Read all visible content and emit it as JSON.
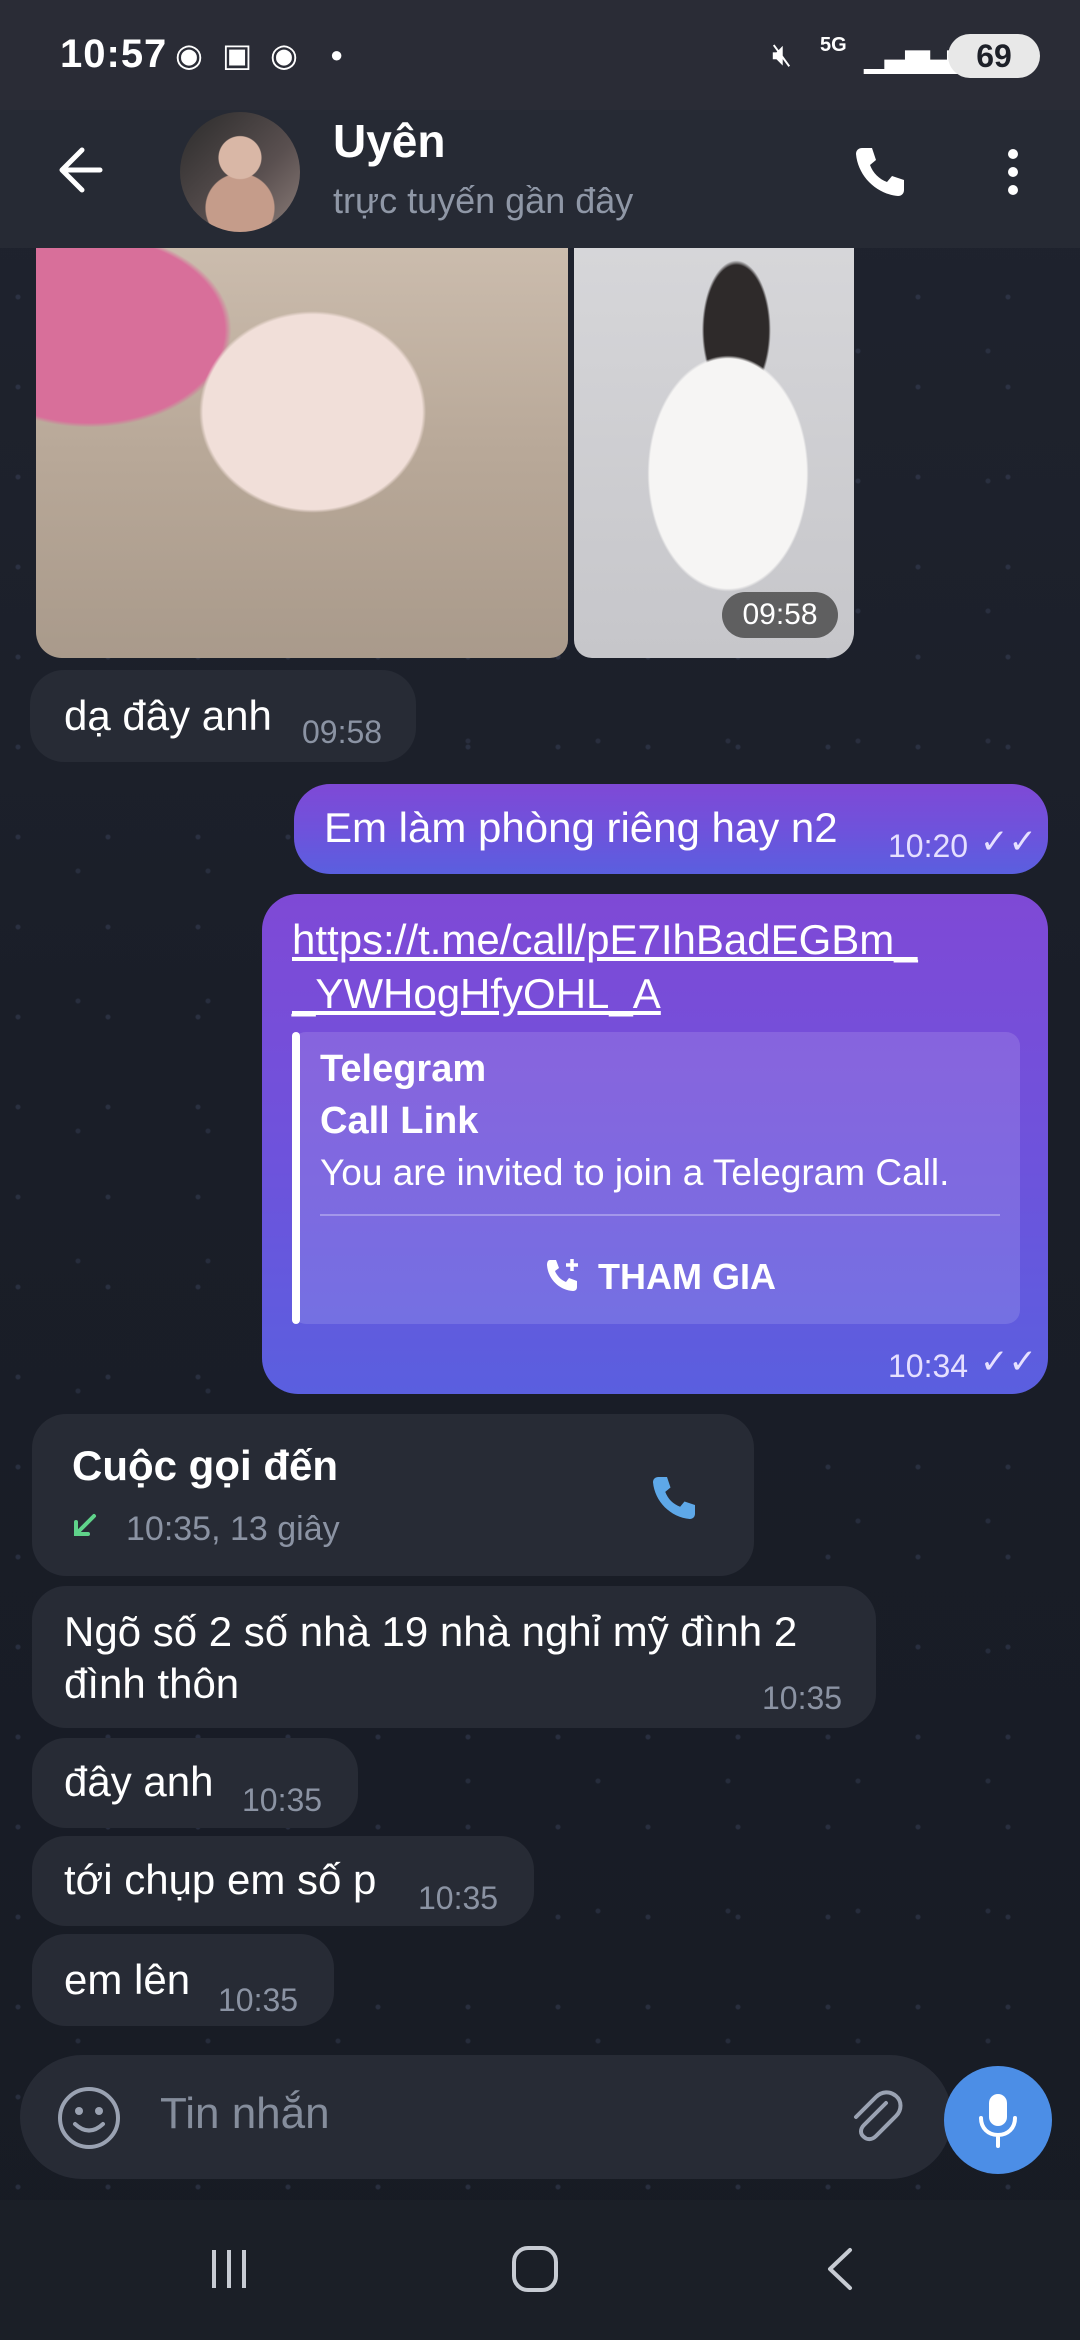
{
  "status_bar": {
    "time": "10:57",
    "network": "5G",
    "battery": "69"
  },
  "header": {
    "contact_name": "Uyên",
    "presence": "trực tuyến gần đây"
  },
  "photos": {
    "timestamp": "09:58"
  },
  "messages": [
    {
      "id": "m1",
      "direction": "in",
      "text": "dạ đây anh",
      "time": "09:58"
    },
    {
      "id": "m2",
      "direction": "out",
      "text": "Em làm phòng riêng hay n2",
      "time": "10:20"
    },
    {
      "id": "m3",
      "direction": "out",
      "link_line1": "https://t.me/call/pE7IhBadEGBm_",
      "link_line2": "_YWHogHfyOHL_A",
      "preview": {
        "site": "Telegram",
        "title": "Call Link",
        "description": "You are invited to join a Telegram Call.",
        "action": "THAM GIA"
      },
      "time": "10:34"
    },
    {
      "id": "m4",
      "direction": "in",
      "type": "call",
      "title": "Cuộc gọi đến",
      "detail": "10:35, 13 giây"
    },
    {
      "id": "m5",
      "direction": "in",
      "line1": "Ngõ số 2 số nhà 19 nhà nghỉ mỹ đình 2",
      "line2": "đình thôn",
      "time": "10:35"
    },
    {
      "id": "m6",
      "direction": "in",
      "text": "đây anh",
      "time": "10:35"
    },
    {
      "id": "m7",
      "direction": "in",
      "text": "tới chụp em số p",
      "time": "10:35"
    },
    {
      "id": "m8",
      "direction": "in",
      "text": "em lên",
      "time": "10:35"
    }
  ],
  "composer": {
    "placeholder": "Tin nhắn"
  },
  "colors": {
    "outgoing_top": "#7f49d6",
    "outgoing_bottom": "#5a5fdf",
    "incoming": "#272b35",
    "accent": "#4c8ee6",
    "call_arrow": "#5fd38a"
  },
  "icons": [
    "back-arrow-icon",
    "phone-icon",
    "more-vert-icon",
    "emoji-icon",
    "attach-icon",
    "mic-icon",
    "call-add-icon",
    "incoming-call-arrow-icon",
    "double-check-icon"
  ]
}
